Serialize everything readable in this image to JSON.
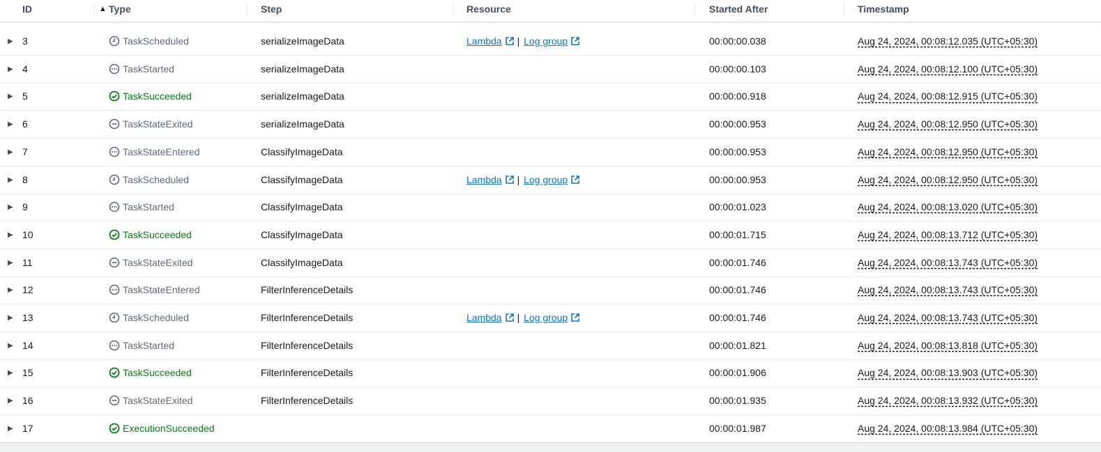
{
  "columns": {
    "id": "ID",
    "type": "Type",
    "step": "Step",
    "resource": "Resource",
    "started_after": "Started After",
    "timestamp": "Timestamp"
  },
  "sort": {
    "column": "ID",
    "direction": "ascending"
  },
  "resource_links": {
    "lambda": "Lambda",
    "separator": "|",
    "log_group": "Log group"
  },
  "rows": [
    {
      "id": "3",
      "type": "TaskScheduled",
      "status": "scheduled",
      "step": "serializeImageData",
      "has_resource": true,
      "started_after": "00:00:00.038",
      "timestamp": "Aug 24, 2024, 00:08:12.035 (UTC+05:30)"
    },
    {
      "id": "4",
      "type": "TaskStarted",
      "status": "pending",
      "step": "serializeImageData",
      "has_resource": false,
      "started_after": "00:00:00.103",
      "timestamp": "Aug 24, 2024, 00:08:12.100 (UTC+05:30)"
    },
    {
      "id": "5",
      "type": "TaskSucceeded",
      "status": "succeeded",
      "step": "serializeImageData",
      "has_resource": false,
      "started_after": "00:00:00.918",
      "timestamp": "Aug 24, 2024, 00:08:12.915 (UTC+05:30)"
    },
    {
      "id": "6",
      "type": "TaskStateExited",
      "status": "exited",
      "step": "serializeImageData",
      "has_resource": false,
      "started_after": "00:00:00.953",
      "timestamp": "Aug 24, 2024, 00:08:12.950 (UTC+05:30)"
    },
    {
      "id": "7",
      "type": "TaskStateEntered",
      "status": "pending",
      "step": "ClassifyImageData",
      "has_resource": false,
      "started_after": "00:00:00.953",
      "timestamp": "Aug 24, 2024, 00:08:12.950 (UTC+05:30)"
    },
    {
      "id": "8",
      "type": "TaskScheduled",
      "status": "scheduled",
      "step": "ClassifyImageData",
      "has_resource": true,
      "started_after": "00:00:00.953",
      "timestamp": "Aug 24, 2024, 00:08:12.950 (UTC+05:30)"
    },
    {
      "id": "9",
      "type": "TaskStarted",
      "status": "pending",
      "step": "ClassifyImageData",
      "has_resource": false,
      "started_after": "00:00:01.023",
      "timestamp": "Aug 24, 2024, 00:08:13.020 (UTC+05:30)"
    },
    {
      "id": "10",
      "type": "TaskSucceeded",
      "status": "succeeded",
      "step": "ClassifyImageData",
      "has_resource": false,
      "started_after": "00:00:01.715",
      "timestamp": "Aug 24, 2024, 00:08:13.712 (UTC+05:30)"
    },
    {
      "id": "11",
      "type": "TaskStateExited",
      "status": "exited",
      "step": "ClassifyImageData",
      "has_resource": false,
      "started_after": "00:00:01.746",
      "timestamp": "Aug 24, 2024, 00:08:13.743 (UTC+05:30)"
    },
    {
      "id": "12",
      "type": "TaskStateEntered",
      "status": "pending",
      "step": "FilterInferenceDetails",
      "has_resource": false,
      "started_after": "00:00:01.746",
      "timestamp": "Aug 24, 2024, 00:08:13.743 (UTC+05:30)"
    },
    {
      "id": "13",
      "type": "TaskScheduled",
      "status": "scheduled",
      "step": "FilterInferenceDetails",
      "has_resource": true,
      "started_after": "00:00:01.746",
      "timestamp": "Aug 24, 2024, 00:08:13.743 (UTC+05:30)"
    },
    {
      "id": "14",
      "type": "TaskStarted",
      "status": "pending",
      "step": "FilterInferenceDetails",
      "has_resource": false,
      "started_after": "00:00:01.821",
      "timestamp": "Aug 24, 2024, 00:08:13.818 (UTC+05:30)"
    },
    {
      "id": "15",
      "type": "TaskSucceeded",
      "status": "succeeded",
      "step": "FilterInferenceDetails",
      "has_resource": false,
      "started_after": "00:00:01.906",
      "timestamp": "Aug 24, 2024, 00:08:13.903 (UTC+05:30)"
    },
    {
      "id": "16",
      "type": "TaskStateExited",
      "status": "exited",
      "step": "FilterInferenceDetails",
      "has_resource": false,
      "started_after": "00:00:01.935",
      "timestamp": "Aug 24, 2024, 00:08:13.932 (UTC+05:30)"
    },
    {
      "id": "17",
      "type": "ExecutionSucceeded",
      "status": "succeeded",
      "step": "",
      "has_resource": false,
      "started_after": "00:00:01.987",
      "timestamp": "Aug 24, 2024, 00:08:13.984 (UTC+05:30)"
    }
  ],
  "icons": {
    "scheduled": "clock-icon",
    "pending": "ellipsis-icon",
    "succeeded": "check-circle-icon",
    "exited": "minus-circle-icon",
    "expand": "caret-right-icon",
    "external": "external-link-icon",
    "sort": "sort-ascending-icon"
  },
  "colors": {
    "success": "#037f0c",
    "neutral": "#5f6b7a",
    "link": "#0972d3",
    "text": "#16191f",
    "border": "#e9ebed"
  }
}
